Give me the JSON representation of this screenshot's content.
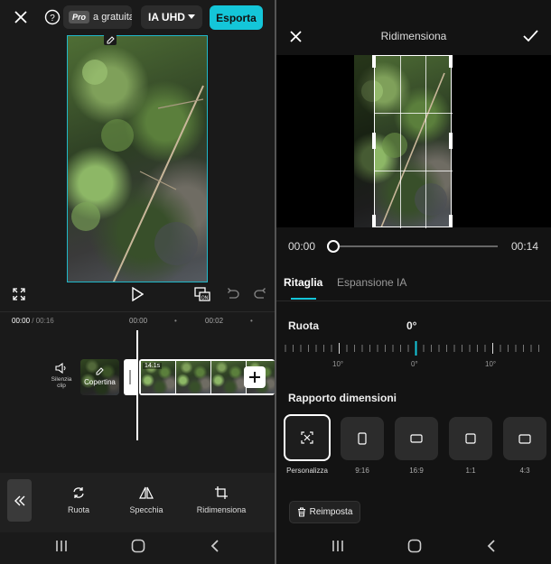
{
  "editor": {
    "pro_badge": "Pro",
    "pro_text": "a gratuita",
    "quality_label": "IA UHD",
    "export_label": "Esporta",
    "timecode_current": "00:00",
    "timecode_total": "/ 00:16",
    "ruler_marks": [
      "00:00",
      "00:02"
    ],
    "mute_label": "Silenzia clip",
    "cover_label": "Copertina",
    "clip_duration": "14.1s",
    "tools": [
      {
        "label": "Ruota",
        "icon": "rotate-icon"
      },
      {
        "label": "Specchia",
        "icon": "mirror-icon"
      },
      {
        "label": "Ridimensiona",
        "icon": "crop-icon"
      }
    ]
  },
  "resize": {
    "title": "Ridimensiona",
    "time_start": "00:00",
    "time_end": "00:14",
    "tabs": [
      "Ritaglia",
      "Espansione IA"
    ],
    "active_tab": "Ritaglia",
    "rotate_label": "Ruota",
    "rotate_value": "0°",
    "ruler_labels": [
      "10°",
      "0°",
      "10°"
    ],
    "ratio_title": "Rapporto dimensioni",
    "ratios": [
      {
        "label": "Personalizza",
        "icon": "custom-crop-icon",
        "selected": true
      },
      {
        "label": "9:16",
        "icon": "portrait-ratio-icon"
      },
      {
        "label": "16:9",
        "icon": "landscape-ratio-icon"
      },
      {
        "label": "1:1",
        "icon": "square-ratio-icon"
      },
      {
        "label": "4:3",
        "icon": "landscape-ratio-icon"
      }
    ],
    "reset_label": "Reimposta"
  },
  "colors": {
    "accent": "#14c6d9",
    "background": "#1a1a1a"
  }
}
